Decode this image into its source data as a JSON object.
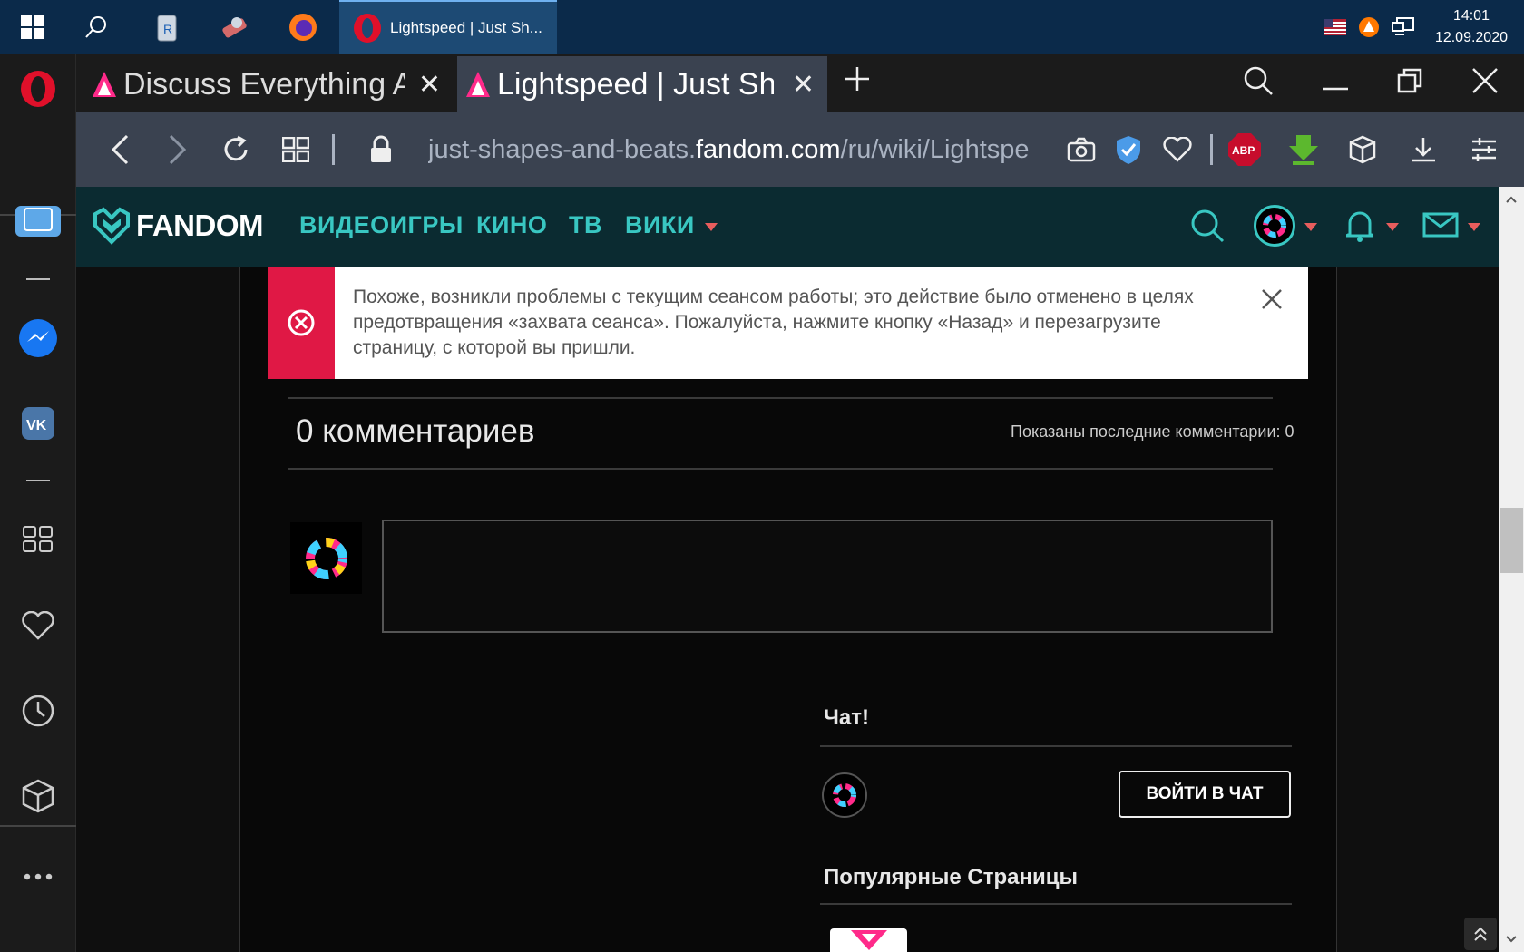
{
  "taskbar": {
    "active_window_label": "Lightspeed | Just Sh...",
    "clock_time": "14:01",
    "clock_date": "12.09.2020"
  },
  "tabs": [
    {
      "title": "Discuss Everything A"
    },
    {
      "title": "Lightspeed | Just Sha"
    }
  ],
  "address": {
    "url_prefix": "just-shapes-and-beats.",
    "url_domain": "fandom.com",
    "url_suffix": "/ru/wiki/Lightspe"
  },
  "fandom": {
    "logo_text": "FANDOM",
    "nav": [
      "ВИДЕОИГРЫ",
      "КИНО",
      "ТВ",
      "ВИКИ"
    ]
  },
  "banner": {
    "message": "Похоже, возникли проблемы с текущим сеансом работы; это действие было отменено в целях предотвращения «захвата сеанса». Пожалуйста, нажмите кнопку «Назад» и перезагрузите страницу, с которой вы пришли."
  },
  "comments": {
    "title": "0 комментариев",
    "shown": "Показаны последние комментарии: 0"
  },
  "chat": {
    "title": "Чат!",
    "button": "ВОЙТИ В ЧАТ"
  },
  "popular": {
    "title": "Популярные Страницы"
  },
  "colors": {
    "fandom_accent": "#39c7c2",
    "error_red": "#e01845",
    "taskbar": "#0b2a4a"
  }
}
